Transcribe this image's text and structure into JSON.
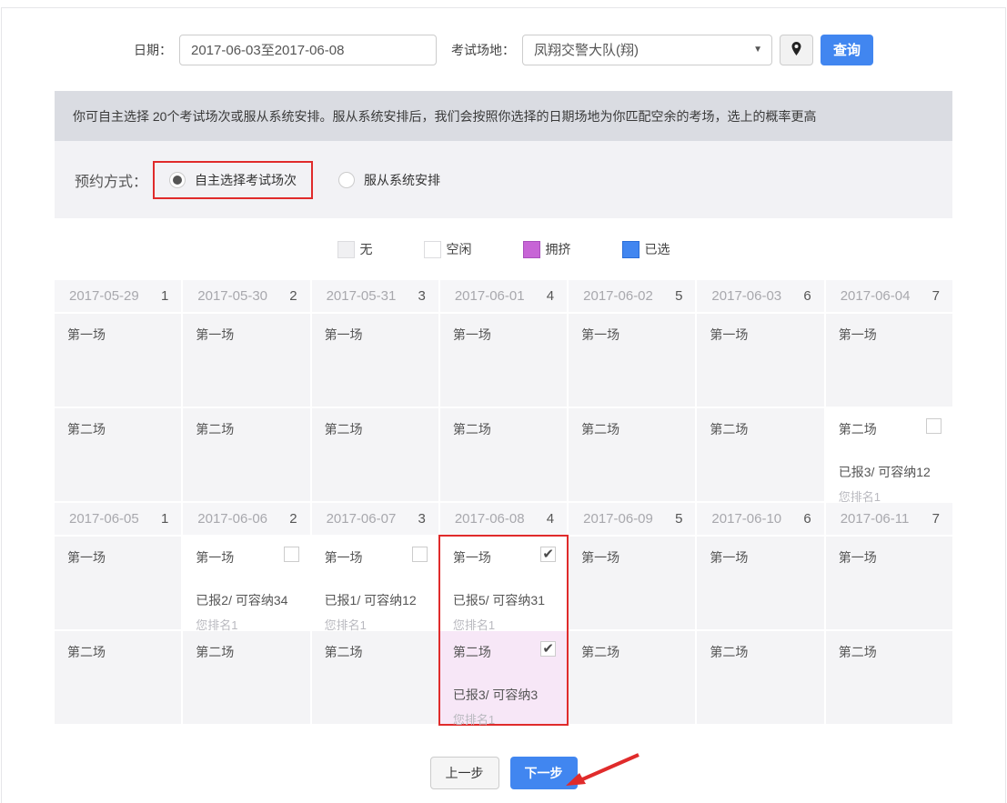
{
  "topbar": {
    "date_label": "日期：",
    "date_value": "2017-06-03至2017-06-08",
    "venue_label": "考试场地：",
    "venue_value": "凤翔交警大队(翔)",
    "query_button": "查询"
  },
  "notice_text": "你可自主选择 20个考试场次或服从系统安排。服从系统安排后，我们会按照你选择的日期场地为你匹配空余的考场，选上的概率更高",
  "booking": {
    "label": "预约方式：",
    "options": [
      {
        "label": "自主选择考试场次",
        "selected": true,
        "annotated": true
      },
      {
        "label": "服从系统安排",
        "selected": false,
        "annotated": false
      }
    ]
  },
  "legend": [
    {
      "label": "无",
      "fill": "#f0f0f2",
      "border": "#dcdcdf"
    },
    {
      "label": "空闲",
      "fill": "#ffffff",
      "border": "#dcdcdf"
    },
    {
      "label": "拥挤",
      "fill": "#c765d6",
      "border": "#a94fbd"
    },
    {
      "label": "已选",
      "fill": "#4186f0",
      "border": "#2a6ed8"
    }
  ],
  "calendar": {
    "weeks": [
      {
        "days": [
          {
            "date": "2017-05-29",
            "dow": "1",
            "highlighted": false,
            "sessions": [
              {
                "name": "第一场",
                "state": "none"
              },
              {
                "name": "第二场",
                "state": "none"
              }
            ]
          },
          {
            "date": "2017-05-30",
            "dow": "2",
            "highlighted": false,
            "sessions": [
              {
                "name": "第一场",
                "state": "none"
              },
              {
                "name": "第二场",
                "state": "none"
              }
            ]
          },
          {
            "date": "2017-05-31",
            "dow": "3",
            "highlighted": false,
            "sessions": [
              {
                "name": "第一场",
                "state": "none"
              },
              {
                "name": "第二场",
                "state": "none"
              }
            ]
          },
          {
            "date": "2017-06-01",
            "dow": "4",
            "highlighted": false,
            "sessions": [
              {
                "name": "第一场",
                "state": "none"
              },
              {
                "name": "第二场",
                "state": "none"
              }
            ]
          },
          {
            "date": "2017-06-02",
            "dow": "5",
            "highlighted": false,
            "sessions": [
              {
                "name": "第一场",
                "state": "none"
              },
              {
                "name": "第二场",
                "state": "none"
              }
            ]
          },
          {
            "date": "2017-06-03",
            "dow": "6",
            "highlighted": false,
            "sessions": [
              {
                "name": "第一场",
                "state": "none"
              },
              {
                "name": "第二场",
                "state": "none"
              }
            ]
          },
          {
            "date": "2017-06-04",
            "dow": "7",
            "highlighted": false,
            "sessions": [
              {
                "name": "第一场",
                "state": "none"
              },
              {
                "name": "第二场",
                "state": "free",
                "checkbox": true,
                "checked": false,
                "stats": "已报3/ 可容纳12",
                "rank": "您排名1"
              }
            ]
          }
        ]
      },
      {
        "days": [
          {
            "date": "2017-06-05",
            "dow": "1",
            "highlighted": false,
            "sessions": [
              {
                "name": "第一场",
                "state": "none"
              },
              {
                "name": "第二场",
                "state": "none"
              }
            ]
          },
          {
            "date": "2017-06-06",
            "dow": "2",
            "highlighted": false,
            "sessions": [
              {
                "name": "第一场",
                "state": "free",
                "checkbox": true,
                "checked": false,
                "stats": "已报2/ 可容纳34",
                "rank": "您排名1"
              },
              {
                "name": "第二场",
                "state": "none"
              }
            ]
          },
          {
            "date": "2017-06-07",
            "dow": "3",
            "highlighted": false,
            "sessions": [
              {
                "name": "第一场",
                "state": "free",
                "checkbox": true,
                "checked": false,
                "stats": "已报1/ 可容纳12",
                "rank": "您排名1"
              },
              {
                "name": "第二场",
                "state": "none"
              }
            ]
          },
          {
            "date": "2017-06-08",
            "dow": "4",
            "highlighted": true,
            "sessions": [
              {
                "name": "第一场",
                "state": "free",
                "checkbox": true,
                "checked": true,
                "stats": "已报5/ 可容纳31",
                "rank": "您排名1"
              },
              {
                "name": "第二场",
                "state": "crowded",
                "checkbox": true,
                "checked": true,
                "stats": "已报3/ 可容纳3",
                "rank": "您排名1"
              }
            ]
          },
          {
            "date": "2017-06-09",
            "dow": "5",
            "highlighted": false,
            "sessions": [
              {
                "name": "第一场",
                "state": "none"
              },
              {
                "name": "第二场",
                "state": "none"
              }
            ]
          },
          {
            "date": "2017-06-10",
            "dow": "6",
            "highlighted": false,
            "sessions": [
              {
                "name": "第一场",
                "state": "none"
              },
              {
                "name": "第二场",
                "state": "none"
              }
            ]
          },
          {
            "date": "2017-06-11",
            "dow": "7",
            "highlighted": false,
            "sessions": [
              {
                "name": "第一场",
                "state": "none"
              },
              {
                "name": "第二场",
                "state": "none"
              }
            ]
          }
        ]
      }
    ]
  },
  "footer": {
    "prev_button": "上一步",
    "next_button": "下一步"
  },
  "colors": {
    "accent_blue": "#4186f0",
    "annotation_red": "#e02b2b",
    "crowded_purple": "#c765d6",
    "crowded_cell_pink": "#f7e7f7"
  }
}
